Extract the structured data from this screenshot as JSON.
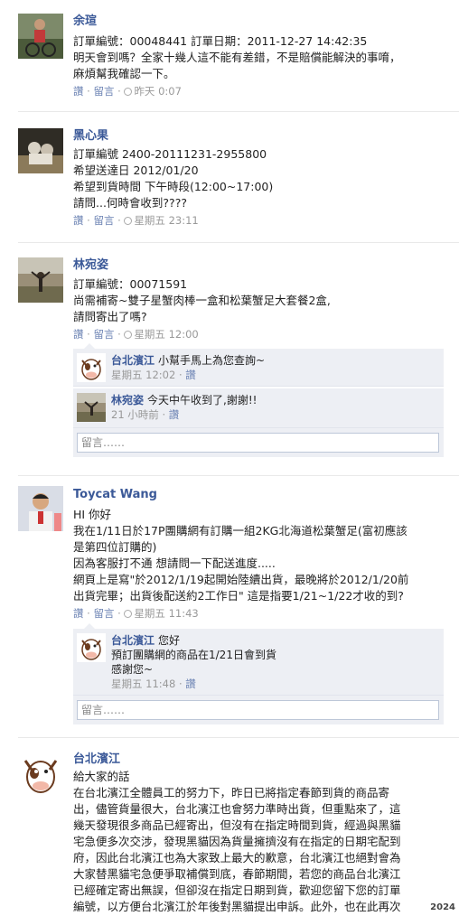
{
  "colors": {
    "link": "#3b5998",
    "meta": "#999999",
    "reply_bg": "#edeff4",
    "action_link": "#6d84b4"
  },
  "posts": [
    {
      "author": "余瑄",
      "lines": [
        "訂單編號：00048441 訂單日期：2011-12-27 14:42:35",
        "明天會到嗎？全家十幾人這不能有差錯，不是賠償能解決的事唷，",
        "麻煩幫我確認一下。"
      ],
      "like": "讚",
      "comment": "留言",
      "dot": "·",
      "time": "昨天 0:07"
    },
    {
      "author": "黑心果",
      "lines": [
        "訂單編號 2400-20111231-2955800",
        "希望送達日 2012/01/20",
        "希望到貨時間 下午時段(12:00~17:00)",
        "請問...何時會收到????"
      ],
      "like": "讚",
      "comment": "留言",
      "dot": "·",
      "time": "星期五 23:11"
    },
    {
      "author": "林宛姿",
      "lines": [
        "訂單編號：00071591",
        "尚需補寄~雙子星蟹肉棒一盒和松葉蟹足大套餐2盒,",
        "請問寄出了嗎?"
      ],
      "like": "讚",
      "comment": "留言",
      "dot": "·",
      "time": "星期五 12:00",
      "replies": [
        {
          "name": "台北濱江",
          "text": "小幫手馬上為您查詢~",
          "time": "星期五 12:02",
          "like": "讚"
        },
        {
          "name": "林宛姿",
          "text": "今天中午收到了,謝謝!!",
          "time": "21 小時前",
          "like": "讚"
        }
      ],
      "comment_placeholder": "留言……"
    },
    {
      "author": "Toycat Wang",
      "lines": [
        "HI 你好",
        "我在1/11日於17P團購網有訂購一組2KG北海道松葉蟹足(富初應該",
        "是第四位訂購的)",
        "因為客服打不通 想請問一下配送進度.....",
        "網頁上是寫\"於2012/1/19起開始陸續出貨，最晚將於2012/1/20前",
        "出貨完畢；出貨後配送約2工作日\" 這是指要1/21~1/22才收的到?"
      ],
      "like": "讚",
      "comment": "留言",
      "dot": "·",
      "time": "星期五 11:43",
      "replies": [
        {
          "name": "台北濱江",
          "text": "您好",
          "text2": "預訂團購網的商品在1/21日會到貨",
          "text3": "感謝您~",
          "time": "星期五 11:48",
          "like": "讚"
        }
      ],
      "comment_placeholder": "留言……"
    },
    {
      "author": "台北濱江",
      "lines": [
        "給大家的話",
        "在台北濱江全體員工的努力下，昨日已將指定春節到貨的商品寄",
        "出，儘管貨量很大，台北濱江也會努力準時出貨，但重點來了，這",
        "幾天發現很多商品已經寄出，但沒有在指定時間到貨，經過與黑貓",
        "宅急便多次交涉，發現黑貓因為貨量擁擠沒有在指定的日期宅配到",
        "府，因此台北濱江也為大家致上最大的歉意，台北濱江也絕對會為",
        "大家替黑貓宅急便爭取補償到底，春節期間，若您的商品台北濱江",
        "已經確定寄出無誤，但卻沒在指定日期到貨，歡迎您留下您的訂單",
        "編號，以方便台北濱江於年後對黑貓提出申訴。此外，也在此再次"
      ]
    }
  ],
  "watermark": "2024"
}
